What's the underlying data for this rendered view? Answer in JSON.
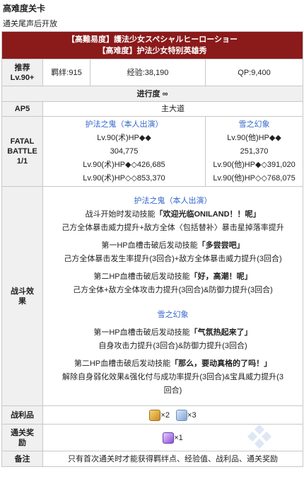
{
  "page": {
    "heading": "高难度关卡",
    "subheading": "通关尾声后开放"
  },
  "title": {
    "jp": "【高難易度】護法少女スペシャルヒーローショー",
    "cn": "【高难度】护法少女特别英雄秀"
  },
  "rec": {
    "label_1": "推荐",
    "label_2": "Lv.90+",
    "bond": "羁绊:915",
    "exp": "经验:38,190",
    "qp": "QP:9,400"
  },
  "progress": "进行度 ∞",
  "ap": {
    "label": "AP5",
    "value": "主大道"
  },
  "fatal": {
    "label_1": "FATAL",
    "label_2": "BATTLE",
    "label_3": "1/1",
    "enemy1": {
      "name": "护法之鬼（本人出演）",
      "lv1": "Lv.90(术)HP◆◆",
      "hp1": "304,775",
      "lv2": "Lv.90(术)HP◆◇426,685",
      "lv3": "Lv.90(术)HP◇◇853,370"
    },
    "enemy2": {
      "name": "雪之幻象",
      "lv1": "Lv.90(他)HP◆◆",
      "hp1": "251,370",
      "lv2": "Lv.90(他)HP◆◇391,020",
      "lv3": "Lv.90(他)HP◇◇768,075"
    }
  },
  "battle": {
    "label_1": "战斗效",
    "label_2": "果",
    "e1_name": "护法之鬼（本人出演）",
    "e1_s1_pre": "战斗开始时发动技能",
    "e1_s1_name": "「欢迎光临ONILAND！！呢」",
    "e1_s1_desc": "己方全体暴击威力提升+敌方全体〈包括替补〉暴击星掉落率提升",
    "e1_s2_pre": "第一HP血槽击破后发动技能",
    "e1_s2_name": "「多尝尝吧」",
    "e1_s2_desc": "己方全体暴击发生率提升(3回合)+敌方全体暴击威力提升(3回合)",
    "e1_s3_pre": "第二HP血槽击破后发动技能",
    "e1_s3_name": "「好，高潮！呢」",
    "e1_s3_desc": "己方全体+敌方全体攻击力提升(3回合)&防御力提升(3回合)",
    "e2_name": "雪之幻象",
    "e2_s1_pre": "第一HP血槽击破后发动技能",
    "e2_s1_name": "「气氛热起来了」",
    "e2_s1_desc": "自身攻击力提升(3回合)&防御力提升(3回合)",
    "e2_s2_pre": "第二HP血槽击破后发动技能",
    "e2_s2_name": "「那么，要动真格的了吗！」",
    "e2_s2_desc_1": "解除自身弱化效果&强化付与成功率提升(3回合)&宝具威力提升(3",
    "e2_s2_desc_2": "回合)"
  },
  "loot": {
    "label": "战利品",
    "item1_count": "×2",
    "item2_count": "×3"
  },
  "reward": {
    "label_1": "通关奖",
    "label_2": "励",
    "count": "×1"
  },
  "note": {
    "label": "备注",
    "text": "只有首次通关时才能获得羁绊点、经验值、战利品、通关奖励"
  },
  "colors": {
    "title_bg": "#8b1a1a",
    "link_blue": "#3366cc",
    "label_bg": "#f0f0f0"
  },
  "icons": {
    "item1": "gold-crest-icon",
    "item2": "blue-feather-icon",
    "reward": "purple-gem-icon",
    "watermark": "mooncell-watermark"
  }
}
